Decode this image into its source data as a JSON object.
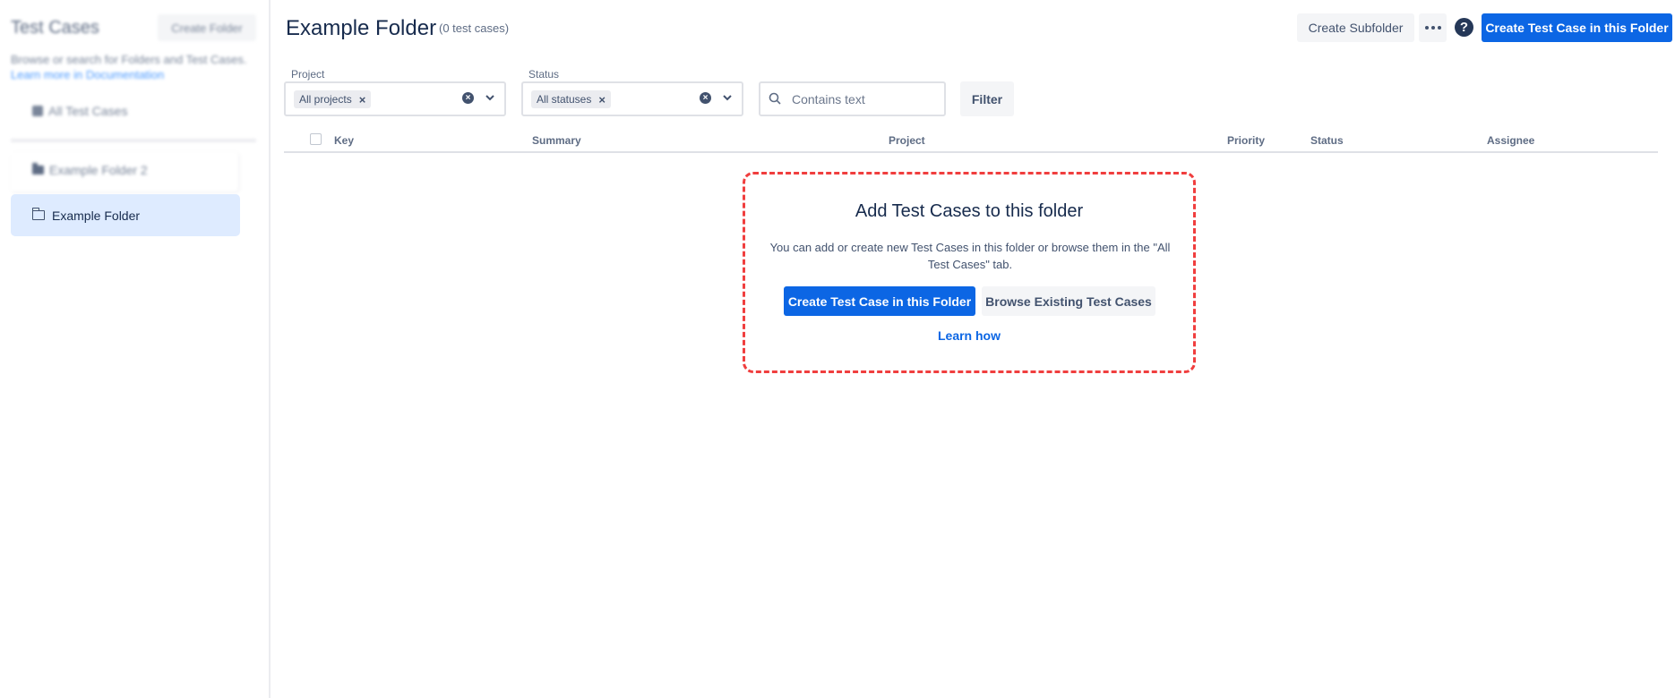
{
  "sidebar": {
    "title": "Test Cases",
    "create_folder_label": "Create Folder",
    "description": "Browse or search for Folders and Test Cases.",
    "doc_link": "Learn more in Documentation",
    "all_test_cases": "All Test Cases",
    "folders": [
      {
        "label": "Example Folder 2",
        "selected": false
      },
      {
        "label": "Example Folder",
        "selected": true
      }
    ]
  },
  "header": {
    "title": "Example Folder",
    "count": "(0 test cases)",
    "create_subfolder": "Create Subfolder",
    "more_icon": "more-horizontal-icon",
    "help_icon": "question-circle-icon",
    "create_test_case": "Create Test Case in this Folder"
  },
  "filters": {
    "project_label": "Project",
    "project_chip": "All projects",
    "status_label": "Status",
    "status_chip": "All statuses",
    "search_placeholder": "Contains text",
    "filter_button": "Filter"
  },
  "table": {
    "columns": [
      "Key",
      "Summary",
      "Project",
      "Priority",
      "Status",
      "Assignee"
    ]
  },
  "empty_state": {
    "title": "Add Test Cases to this folder",
    "description": "You can add or create new Test Cases in this folder or browse them in the \"All Test Cases\" tab.",
    "create_button": "Create Test Case in this Folder",
    "browse_button": "Browse Existing Test Cases",
    "learn_link": "Learn how"
  },
  "colors": {
    "primary": "#0c66e4",
    "highlight_border": "#f03e3e",
    "selected_bg": "#deebff"
  }
}
